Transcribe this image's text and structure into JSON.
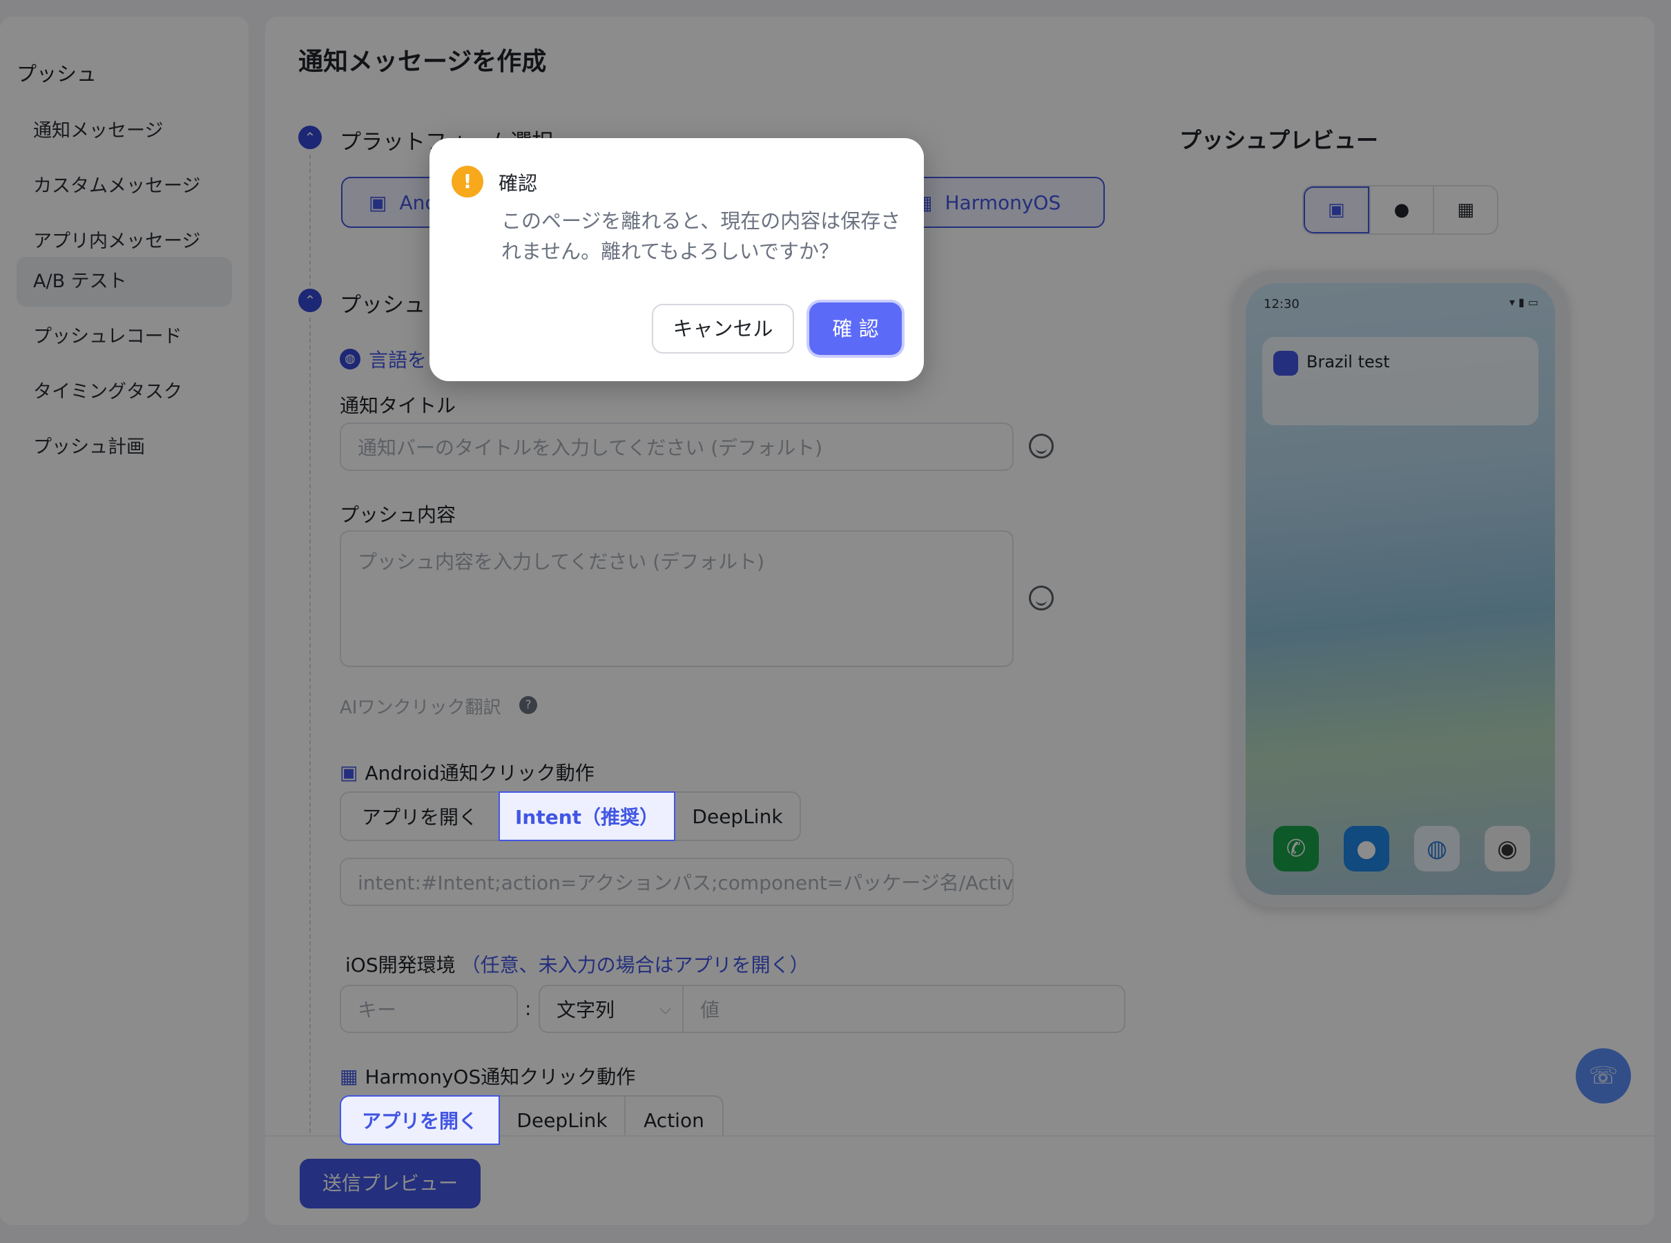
{
  "sidebar": {
    "title": "プッシュ",
    "items": [
      {
        "label": "通知メッセージ"
      },
      {
        "label": "カスタムメッセージ"
      },
      {
        "label": "アプリ内メッセージ"
      },
      {
        "label": "A/B テスト"
      },
      {
        "label": "プッシュレコード"
      },
      {
        "label": "タイミングタスク"
      },
      {
        "label": "プッシュ計画"
      }
    ]
  },
  "main": {
    "title": "通知メッセージを作成",
    "section_platform": {
      "title": "プラットフォーム選択",
      "android_label": "And",
      "harmony_label": "HarmonyOS"
    },
    "section_push": {
      "title": "プッシュ",
      "language_link": "言語を"
    },
    "notification_title": {
      "label": "通知タイトル",
      "placeholder": "通知バーのタイトルを入力してください (デフォルト)"
    },
    "push_content": {
      "label": "プッシュ内容",
      "placeholder": "プッシュ内容を入力してください (デフォルト)"
    },
    "ai_translate": "AIワンクリック翻訳",
    "android_action": {
      "label": "Android通知クリック動作",
      "options": [
        "アプリを開く",
        "Intent（推奨）",
        "DeepLink"
      ],
      "selected": "Intent（推奨）",
      "intent_placeholder": "intent:#Intent;action=アクションパス;component=パッケージ名/Activity;"
    },
    "ios_env": {
      "label": "iOS開発環境",
      "hint": "（任意、未入力の場合はアプリを開く）",
      "key_placeholder": "キー",
      "separator": ":",
      "type_value": "文字列",
      "value_placeholder": "値"
    },
    "harmony_action": {
      "label": "HarmonyOS通知クリック動作",
      "options": [
        "アプリを開く",
        "DeepLink",
        "Action"
      ],
      "selected": "アプリを開く"
    },
    "send_preview_button": "送信プレビュー"
  },
  "preview": {
    "title": "プッシュプレビュー",
    "status_time": "12:30",
    "notification_title": "Brazil test"
  },
  "modal": {
    "title": "確認",
    "body": "このページを離れると、現在の内容は保存されません。離れてもよろしいですか？",
    "cancel_label": "キャンセル",
    "ok_label": "確 認"
  },
  "colors": {
    "accent": "#4256e3",
    "modal_ok": "#5b6af7",
    "warning": "#f7a81b",
    "overlay": "rgba(0,0,0,0.45)"
  }
}
